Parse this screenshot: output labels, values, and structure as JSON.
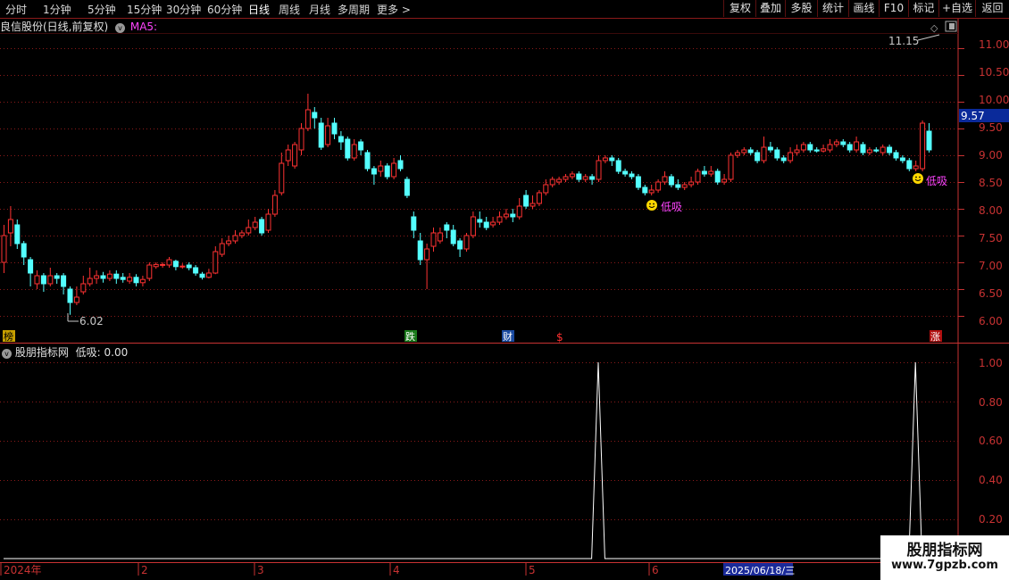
{
  "toolbar": {
    "periods": [
      "分时",
      "1分钟",
      "5分钟",
      "15分钟",
      "30分钟",
      "60分钟",
      "日线",
      "周线",
      "月线",
      "多周期",
      "更多 >"
    ],
    "active_period": "日线",
    "buttons": [
      "复权",
      "叠加",
      "多股",
      "统计",
      "画线",
      "F10",
      "标记",
      "+自选",
      "返回"
    ]
  },
  "chart_header": {
    "title": "良信股份(日线,前复权)",
    "ma_label": "MA5:"
  },
  "price_axis": {
    "ticks": [
      "11.00",
      "10.50",
      "10.00",
      "9.50",
      "9.00",
      "8.50",
      "8.00",
      "7.50",
      "7.00",
      "6.50",
      "6.00"
    ],
    "last_price": "9.57"
  },
  "annotations": {
    "high": "11.15",
    "low": "6.02",
    "signal_label": "低吸"
  },
  "event_markers": {
    "bang": "榜",
    "die": "跌",
    "cai": "财",
    "dollar": "$",
    "zhang": "涨"
  },
  "indicator_header": {
    "name": "股朋指标网",
    "value_label": "低吸: 0.00"
  },
  "indicator_axis": {
    "ticks": [
      "1.00",
      "0.80",
      "0.60",
      "0.40",
      "0.20"
    ]
  },
  "date_axis": {
    "labels": [
      "2024年",
      "2",
      "3",
      "4",
      "5",
      "6"
    ],
    "cursor_date": "2025/06/18/三"
  },
  "watermark": {
    "title": "股朋指标网",
    "url": "www.7gpzb.com"
  },
  "colors": {
    "up": "#ff3232",
    "down": "#54ffff",
    "grid": "#8b1a1a",
    "signal": "#ff44ff",
    "axis_red": "#c83232"
  },
  "chart_data": {
    "type": "candlestick",
    "ylim": [
      5.7,
      11.2
    ],
    "candles": [
      [
        7.0,
        7.5,
        7.7,
        6.8
      ],
      [
        7.55,
        7.8,
        8.05,
        7.3
      ],
      [
        7.7,
        7.35,
        7.8,
        7.25
      ],
      [
        7.35,
        7.1,
        7.4,
        6.95
      ],
      [
        7.05,
        6.8,
        7.1,
        6.55
      ],
      [
        6.6,
        6.75,
        6.85,
        6.5
      ],
      [
        6.75,
        6.6,
        6.8,
        6.45
      ],
      [
        6.6,
        6.75,
        6.9,
        6.55
      ],
      [
        6.75,
        6.7,
        6.8,
        6.6
      ],
      [
        6.75,
        6.55,
        6.8,
        6.4
      ],
      [
        6.5,
        6.25,
        6.55,
        6.02
      ],
      [
        6.25,
        6.35,
        6.55,
        6.2
      ],
      [
        6.45,
        6.6,
        6.75,
        6.4
      ],
      [
        6.6,
        6.7,
        6.9,
        6.55
      ],
      [
        6.7,
        6.75,
        6.85,
        6.6
      ],
      [
        6.75,
        6.7,
        6.82,
        6.62
      ],
      [
        6.7,
        6.78,
        6.85,
        6.65
      ],
      [
        6.78,
        6.7,
        6.85,
        6.6
      ],
      [
        6.72,
        6.68,
        6.8,
        6.62
      ],
      [
        6.65,
        6.72,
        6.8,
        6.6
      ],
      [
        6.72,
        6.62,
        6.78,
        6.55
      ],
      [
        6.62,
        6.68,
        6.75,
        6.55
      ],
      [
        6.7,
        6.95,
        7.0,
        6.65
      ],
      [
        6.92,
        6.96,
        7.0,
        6.88
      ],
      [
        6.95,
        6.96,
        7.0,
        6.9
      ],
      [
        6.95,
        7.05,
        7.1,
        6.9
      ],
      [
        7.02,
        6.92,
        7.05,
        6.85
      ],
      [
        6.92,
        6.93,
        6.98,
        6.88
      ],
      [
        6.95,
        6.9,
        7.0,
        6.85
      ],
      [
        6.9,
        6.8,
        6.95,
        6.75
      ],
      [
        6.78,
        6.72,
        6.82,
        6.68
      ],
      [
        6.72,
        6.8,
        6.88,
        6.7
      ],
      [
        6.8,
        7.2,
        7.3,
        6.78
      ],
      [
        7.15,
        7.35,
        7.45,
        7.1
      ],
      [
        7.35,
        7.4,
        7.5,
        7.3
      ],
      [
        7.4,
        7.5,
        7.6,
        7.35
      ],
      [
        7.5,
        7.55,
        7.6,
        7.45
      ],
      [
        7.55,
        7.65,
        7.8,
        7.5
      ],
      [
        7.65,
        7.75,
        7.85,
        7.6
      ],
      [
        7.8,
        7.55,
        7.85,
        7.5
      ],
      [
        7.6,
        7.9,
        8.0,
        7.55
      ],
      [
        7.9,
        8.25,
        8.35,
        7.85
      ],
      [
        8.3,
        8.85,
        9.05,
        8.25
      ],
      [
        8.9,
        9.1,
        9.2,
        8.8
      ],
      [
        8.8,
        9.2,
        9.25,
        8.75
      ],
      [
        9.1,
        9.5,
        9.6,
        9.0
      ],
      [
        9.5,
        9.85,
        10.15,
        9.45
      ],
      [
        9.8,
        9.7,
        9.9,
        9.5
      ],
      [
        9.6,
        9.15,
        9.7,
        9.1
      ],
      [
        9.2,
        9.55,
        9.7,
        9.15
      ],
      [
        9.6,
        9.4,
        9.7,
        9.3
      ],
      [
        9.35,
        9.25,
        9.45,
        9.1
      ],
      [
        9.3,
        8.95,
        9.35,
        8.9
      ],
      [
        8.95,
        9.2,
        9.3,
        8.9
      ],
      [
        9.25,
        9.1,
        9.3,
        9.0
      ],
      [
        9.05,
        8.75,
        9.1,
        8.7
      ],
      [
        8.75,
        8.65,
        8.8,
        8.45
      ],
      [
        8.7,
        8.8,
        8.9,
        8.6
      ],
      [
        8.8,
        8.6,
        8.85,
        8.55
      ],
      [
        8.6,
        8.85,
        8.95,
        8.55
      ],
      [
        8.9,
        8.75,
        9.0,
        8.7
      ],
      [
        8.55,
        8.25,
        8.6,
        8.2
      ],
      [
        7.85,
        7.6,
        7.95,
        7.45
      ],
      [
        7.4,
        7.05,
        7.55,
        6.95
      ],
      [
        7.05,
        7.25,
        7.35,
        6.5
      ],
      [
        7.3,
        7.55,
        7.65,
        7.2
      ],
      [
        7.4,
        7.55,
        7.65,
        7.35
      ],
      [
        7.7,
        7.6,
        7.75,
        7.45
      ],
      [
        7.6,
        7.35,
        7.7,
        7.3
      ],
      [
        7.4,
        7.25,
        7.45,
        7.1
      ],
      [
        7.25,
        7.5,
        7.55,
        7.2
      ],
      [
        7.5,
        7.85,
        7.95,
        7.45
      ],
      [
        7.8,
        7.75,
        7.95,
        7.65
      ],
      [
        7.75,
        7.65,
        7.85,
        7.6
      ],
      [
        7.7,
        7.75,
        7.85,
        7.65
      ],
      [
        7.75,
        7.85,
        7.95,
        7.7
      ],
      [
        7.85,
        7.9,
        8.0,
        7.8
      ],
      [
        7.9,
        7.85,
        8.0,
        7.75
      ],
      [
        7.85,
        8.05,
        8.2,
        7.8
      ],
      [
        8.25,
        8.05,
        8.35,
        8.0
      ],
      [
        8.05,
        8.1,
        8.25,
        8.0
      ],
      [
        8.1,
        8.3,
        8.35,
        8.05
      ],
      [
        8.3,
        8.45,
        8.55,
        8.25
      ],
      [
        8.45,
        8.55,
        8.6,
        8.4
      ],
      [
        8.5,
        8.55,
        8.6,
        8.45
      ],
      [
        8.55,
        8.6,
        8.65,
        8.5
      ],
      [
        8.6,
        8.65,
        8.7,
        8.55
      ],
      [
        8.65,
        8.55,
        8.7,
        8.5
      ],
      [
        8.55,
        8.6,
        8.65,
        8.5
      ],
      [
        8.6,
        8.55,
        8.65,
        8.45
      ],
      [
        8.55,
        8.9,
        9.0,
        8.5
      ],
      [
        8.9,
        8.95,
        9.0,
        8.85
      ],
      [
        8.95,
        8.9,
        9.0,
        8.8
      ],
      [
        8.9,
        8.7,
        8.95,
        8.65
      ],
      [
        8.7,
        8.65,
        8.75,
        8.6
      ],
      [
        8.65,
        8.6,
        8.7,
        8.55
      ],
      [
        8.6,
        8.4,
        8.65,
        8.35
      ],
      [
        8.4,
        8.3,
        8.45,
        8.25
      ],
      [
        8.3,
        8.35,
        8.45,
        8.25
      ],
      [
        8.35,
        8.5,
        8.55,
        8.3
      ],
      [
        8.5,
        8.6,
        8.7,
        8.45
      ],
      [
        8.6,
        8.45,
        8.65,
        8.4
      ],
      [
        8.45,
        8.4,
        8.55,
        8.35
      ],
      [
        8.4,
        8.45,
        8.5,
        8.35
      ],
      [
        8.45,
        8.5,
        8.6,
        8.4
      ],
      [
        8.5,
        8.7,
        8.75,
        8.45
      ],
      [
        8.7,
        8.65,
        8.8,
        8.6
      ],
      [
        8.65,
        8.7,
        8.8,
        8.6
      ],
      [
        8.7,
        8.5,
        8.75,
        8.45
      ],
      [
        8.5,
        8.55,
        8.65,
        8.45
      ],
      [
        8.55,
        9.0,
        9.05,
        8.5
      ],
      [
        9.0,
        9.05,
        9.1,
        8.95
      ],
      [
        9.05,
        9.1,
        9.15,
        9.0
      ],
      [
        9.1,
        9.05,
        9.15,
        9.0
      ],
      [
        9.05,
        8.9,
        9.1,
        8.85
      ],
      [
        8.9,
        9.15,
        9.35,
        8.85
      ],
      [
        9.15,
        9.1,
        9.25,
        9.05
      ],
      [
        9.1,
        8.95,
        9.15,
        8.9
      ],
      [
        8.95,
        8.9,
        9.0,
        8.85
      ],
      [
        8.9,
        9.05,
        9.15,
        8.85
      ],
      [
        9.05,
        9.1,
        9.2,
        9.0
      ],
      [
        9.1,
        9.2,
        9.25,
        9.05
      ],
      [
        9.2,
        9.1,
        9.25,
        9.05
      ],
      [
        9.1,
        9.08,
        9.15,
        9.05
      ],
      [
        9.08,
        9.12,
        9.2,
        9.05
      ],
      [
        9.1,
        9.2,
        9.3,
        9.05
      ],
      [
        9.2,
        9.25,
        9.3,
        9.15
      ],
      [
        9.25,
        9.2,
        9.3,
        9.15
      ],
      [
        9.2,
        9.1,
        9.25,
        9.05
      ],
      [
        9.1,
        9.25,
        9.35,
        9.05
      ],
      [
        9.2,
        9.05,
        9.25,
        9.0
      ],
      [
        9.05,
        9.1,
        9.15,
        9.0
      ],
      [
        9.1,
        9.08,
        9.15,
        9.05
      ],
      [
        9.05,
        9.15,
        9.2,
        9.0
      ],
      [
        9.15,
        9.05,
        9.2,
        9.0
      ],
      [
        9.05,
        8.95,
        9.1,
        8.9
      ],
      [
        8.95,
        8.9,
        9.0,
        8.85
      ],
      [
        8.9,
        8.75,
        8.95,
        8.7
      ],
      [
        8.75,
        8.8,
        8.9,
        8.7
      ],
      [
        8.75,
        9.6,
        9.65,
        8.7
      ],
      [
        9.45,
        9.1,
        9.6,
        9.05
      ]
    ],
    "signals": [
      {
        "index": 90,
        "value": 1.0
      },
      {
        "index": 138,
        "value": 1.0
      }
    ]
  }
}
